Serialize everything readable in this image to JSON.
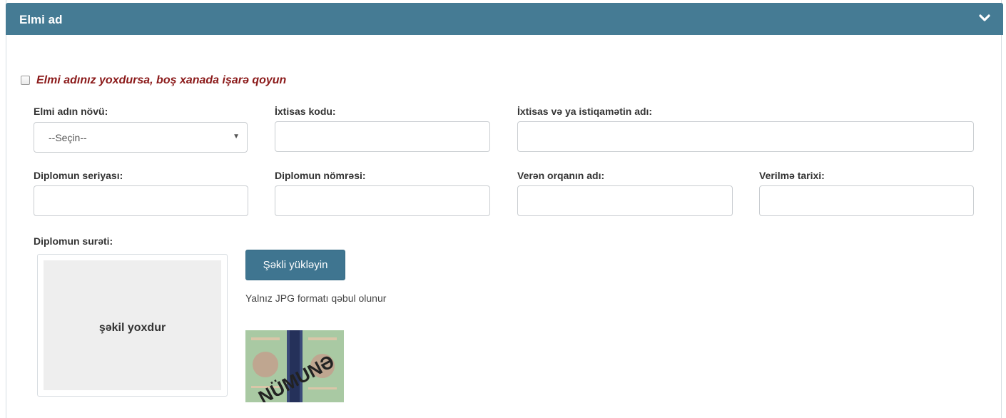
{
  "panel": {
    "title": "Elmi ad",
    "toggle_icon": "chevron-down-icon",
    "header_color": "#457b94"
  },
  "no_degree": {
    "label": "Elmi adınız yoxdursa, boş xanada işarə qoyun",
    "checked": false,
    "label_color": "#8b1a1a"
  },
  "fields": {
    "degree_type": {
      "label": "Elmi adın növü:",
      "value": "--Seçin--"
    },
    "specialty_code": {
      "label": "İxtisas kodu:",
      "value": ""
    },
    "specialty_name": {
      "label": "İxtisas və ya istiqamətin adı:",
      "value": ""
    },
    "diploma_series": {
      "label": "Diplomun seriyası:",
      "value": ""
    },
    "diploma_number": {
      "label": "Diplomun nömrəsi:",
      "value": ""
    },
    "issuer_name": {
      "label": "Verən orqanın adı:",
      "value": ""
    },
    "issue_date": {
      "label": "Verilmə tarixi:",
      "value": ""
    }
  },
  "diploma_copy": {
    "label": "Diplomun surəti:",
    "placeholder_text": "şəkil yoxdur",
    "upload_button": "Şəkli yükləyin",
    "format_note": "Yalnız JPG formatı qəbul olunur",
    "sample_stamp": "NÜMUNƏ",
    "button_color": "#3f7590"
  }
}
